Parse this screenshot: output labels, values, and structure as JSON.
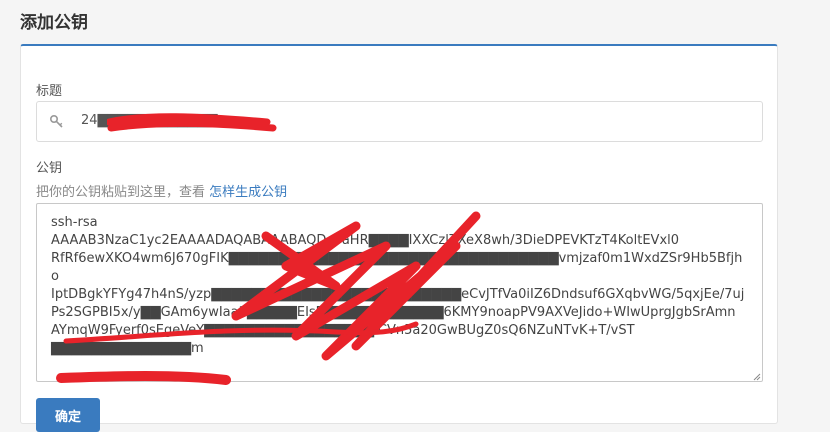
{
  "page": {
    "title": "添加公钥"
  },
  "form": {
    "title_label": "标题",
    "title_value": "24▇▇▇▇▇▇▇▇▇▇▇▇com",
    "title_icon": "key-icon",
    "key_label": "公钥",
    "hint_prefix": "把你的公钥粘贴到这里，查看 ",
    "hint_link": "怎样生成公钥",
    "key_value": "ssh-rsa\nAAAAB3NzaC1yc2EAAAADAQABAAABAQDc7aHR▇▇▇▇IXXCzlZXeX8wh/3DieDPEVKTzT4KoltEVxl0\nRfRf6ewXKO4wm6J670gFIK▇▇▇▇▇▇▇▇▇▇▇▇▇▇▇▇▇▇▇▇▇▇▇▇▇▇▇▇▇▇▇▇▇vmjzaf0m1WxdZSr9Hb5Bfjho\nIptDBgkYFYg47h4nS/yzp▇▇▇▇▇▇▇▇▇▇▇▇▇▇▇▇▇▇▇▇▇▇▇▇▇eCvJTfVa0iIZ6Dndsuf6GXqbvWG/5qxjEe/7uj\nPs2SGPBI5x/y▇▇GAm6ywIaa3▇▇▇▇▇EIsP▇▇▇▇▇▇▇▇▇▇▇▇6KMY9noapPV9AXVeJido+WIwUprgJgbSrAmn\nAYmqW9Fyerf0sEgeVeY▇▇▇▇▇▇▇▇▇▇▇▇▇▇▇▇▇ICVn5a20GwBUgZ0sQ6NZuNTvK+T/vST\n▇▇▇▇▇▇▇▇▇▇▇▇▇▇m",
    "confirm_label": "确定"
  },
  "colors": {
    "accent": "#3a7bbf",
    "redaction": "#e8232a"
  }
}
